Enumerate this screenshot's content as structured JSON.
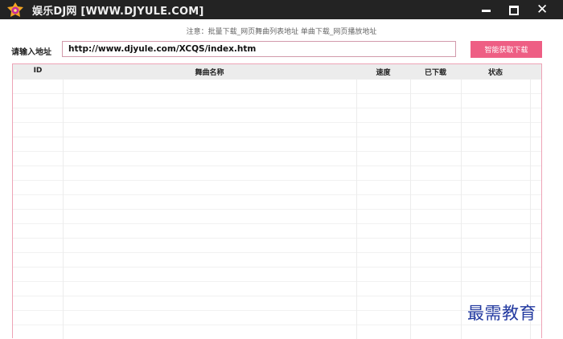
{
  "window": {
    "title": "娱乐DJ网 [WWW.DJYULE.COM]",
    "icon": "logo-icon",
    "minimize": "—",
    "maximize": "□",
    "close": "✕"
  },
  "notice": "注意：批量下载_网页舞曲列表地址 单曲下载_网页播放地址",
  "url_row": {
    "label": "请输入地址",
    "value": "http://www.djyule.com/XCQS/index.htm",
    "button": "智能获取下载"
  },
  "table": {
    "columns": [
      "ID",
      "舞曲名称",
      "速度",
      "已下载",
      "状态"
    ],
    "rows": []
  },
  "watermark": "最需教育",
  "colors": {
    "titlebar": "#232323",
    "accent": "#ee5e84",
    "table_border": "#eea3b6",
    "watermark": "#233aa0"
  }
}
